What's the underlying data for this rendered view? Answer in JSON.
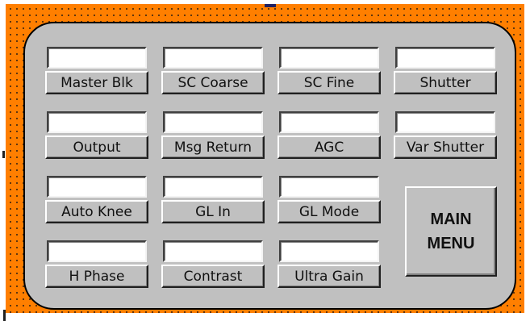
{
  "colors": {
    "canvas": "#ff7f00",
    "panel": "#c0c0c0",
    "field": "#ffffff"
  },
  "controls": [
    {
      "id": "master-blk",
      "label": "Master Blk",
      "value": ""
    },
    {
      "id": "sc-coarse",
      "label": "SC Coarse",
      "value": ""
    },
    {
      "id": "sc-fine",
      "label": "SC Fine",
      "value": ""
    },
    {
      "id": "shutter",
      "label": "Shutter",
      "value": ""
    },
    {
      "id": "output",
      "label": "Output",
      "value": ""
    },
    {
      "id": "msg-return",
      "label": "Msg Return",
      "value": ""
    },
    {
      "id": "agc",
      "label": "AGC",
      "value": ""
    },
    {
      "id": "var-shutter",
      "label": "Var Shutter",
      "value": ""
    },
    {
      "id": "auto-knee",
      "label": "Auto Knee",
      "value": ""
    },
    {
      "id": "gl-in",
      "label": "GL In",
      "value": ""
    },
    {
      "id": "gl-mode",
      "label": "GL Mode",
      "value": ""
    },
    {
      "id": "h-phase",
      "label": "H Phase",
      "value": ""
    },
    {
      "id": "contrast",
      "label": "Contrast",
      "value": ""
    },
    {
      "id": "ultra-gain",
      "label": "Ultra Gain",
      "value": ""
    }
  ],
  "main_menu": {
    "line1": "MAIN",
    "line2": "MENU"
  }
}
